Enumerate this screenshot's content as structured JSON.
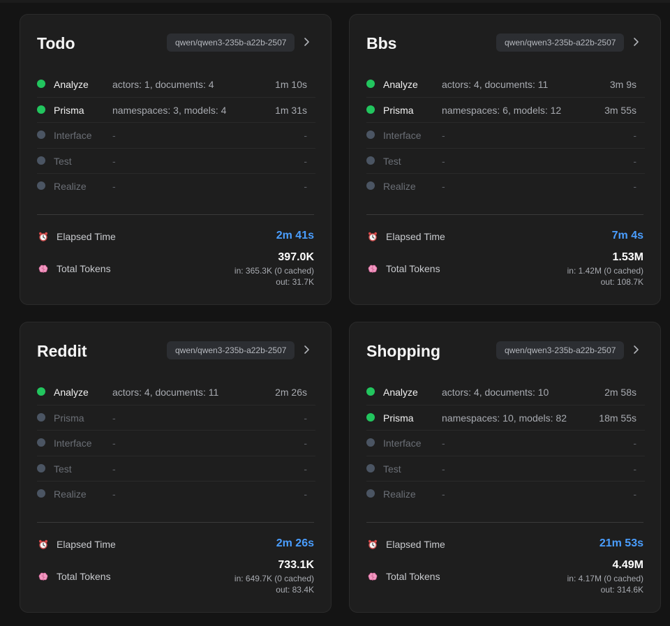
{
  "cards": [
    {
      "title": "Todo",
      "model": "qwen/qwen3-235b-a22b-2507",
      "phases": [
        {
          "name": "Analyze",
          "detail": "actors: 1, documents: 4",
          "time": "1m 10s",
          "active": true
        },
        {
          "name": "Prisma",
          "detail": "namespaces: 3, models: 4",
          "time": "1m 31s",
          "active": true
        },
        {
          "name": "Interface",
          "detail": "-",
          "time": "-",
          "active": false
        },
        {
          "name": "Test",
          "detail": "-",
          "time": "-",
          "active": false
        },
        {
          "name": "Realize",
          "detail": "-",
          "time": "-",
          "active": false
        }
      ],
      "elapsed_label": "Elapsed Time",
      "elapsed_value": "2m 41s",
      "tokens_label": "Total Tokens",
      "tokens_total": "397.0K",
      "tokens_in": "in: 365.3K (0 cached)",
      "tokens_out": "out: 31.7K"
    },
    {
      "title": "Bbs",
      "model": "qwen/qwen3-235b-a22b-2507",
      "phases": [
        {
          "name": "Analyze",
          "detail": "actors: 4, documents: 11",
          "time": "3m 9s",
          "active": true
        },
        {
          "name": "Prisma",
          "detail": "namespaces: 6, models: 12",
          "time": "3m 55s",
          "active": true
        },
        {
          "name": "Interface",
          "detail": "-",
          "time": "-",
          "active": false
        },
        {
          "name": "Test",
          "detail": "-",
          "time": "-",
          "active": false
        },
        {
          "name": "Realize",
          "detail": "-",
          "time": "-",
          "active": false
        }
      ],
      "elapsed_label": "Elapsed Time",
      "elapsed_value": "7m 4s",
      "tokens_label": "Total Tokens",
      "tokens_total": "1.53M",
      "tokens_in": "in: 1.42M (0 cached)",
      "tokens_out": "out: 108.7K"
    },
    {
      "title": "Reddit",
      "model": "qwen/qwen3-235b-a22b-2507",
      "phases": [
        {
          "name": "Analyze",
          "detail": "actors: 4, documents: 11",
          "time": "2m 26s",
          "active": true
        },
        {
          "name": "Prisma",
          "detail": "-",
          "time": "-",
          "active": false
        },
        {
          "name": "Interface",
          "detail": "-",
          "time": "-",
          "active": false
        },
        {
          "name": "Test",
          "detail": "-",
          "time": "-",
          "active": false
        },
        {
          "name": "Realize",
          "detail": "-",
          "time": "-",
          "active": false
        }
      ],
      "elapsed_label": "Elapsed Time",
      "elapsed_value": "2m 26s",
      "tokens_label": "Total Tokens",
      "tokens_total": "733.1K",
      "tokens_in": "in: 649.7K (0 cached)",
      "tokens_out": "out: 83.4K"
    },
    {
      "title": "Shopping",
      "model": "qwen/qwen3-235b-a22b-2507",
      "phases": [
        {
          "name": "Analyze",
          "detail": "actors: 4, documents: 10",
          "time": "2m 58s",
          "active": true
        },
        {
          "name": "Prisma",
          "detail": "namespaces: 10, models: 82",
          "time": "18m 55s",
          "active": true
        },
        {
          "name": "Interface",
          "detail": "-",
          "time": "-",
          "active": false
        },
        {
          "name": "Test",
          "detail": "-",
          "time": "-",
          "active": false
        },
        {
          "name": "Realize",
          "detail": "-",
          "time": "-",
          "active": false
        }
      ],
      "elapsed_label": "Elapsed Time",
      "elapsed_value": "21m 53s",
      "tokens_label": "Total Tokens",
      "tokens_total": "4.49M",
      "tokens_in": "in: 4.17M (0 cached)",
      "tokens_out": "out: 314.6K"
    }
  ],
  "icons": {
    "chevron": "chevron-right-icon",
    "elapsed": "alarm-clock-icon",
    "tokens": "brain-icon"
  },
  "colors": {
    "active": "#22c55e",
    "inactive": "#4b5563",
    "elapsed": "#4a9eff"
  }
}
